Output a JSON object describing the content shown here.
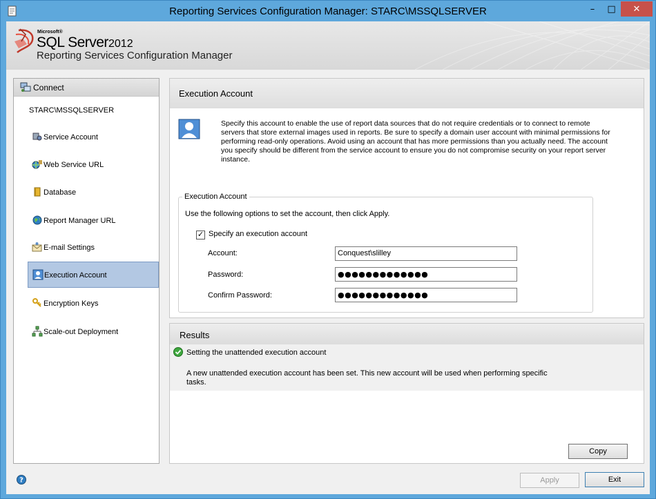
{
  "window": {
    "title": "Reporting Services Configuration Manager: STARC\\MSSQLSERVER",
    "controls": {
      "minimize": "–",
      "maximize": "□",
      "close": "✕"
    }
  },
  "banner": {
    "microsoft": "Microsoft®",
    "product": "SQL Server",
    "year": "2012",
    "subtitle": "Reporting Services Configuration Manager"
  },
  "sidebar": {
    "connect": "Connect",
    "server": "STARC\\MSSQLSERVER",
    "items": [
      {
        "label": "Service Account",
        "icon": "service-account-icon"
      },
      {
        "label": "Web Service URL",
        "icon": "web-service-icon"
      },
      {
        "label": "Database",
        "icon": "database-icon"
      },
      {
        "label": "Report Manager URL",
        "icon": "globe-icon"
      },
      {
        "label": "E-mail Settings",
        "icon": "email-icon"
      },
      {
        "label": "Execution Account",
        "icon": "user-icon",
        "selected": true
      },
      {
        "label": "Encryption Keys",
        "icon": "keys-icon"
      },
      {
        "label": "Scale-out Deployment",
        "icon": "network-icon"
      }
    ]
  },
  "main": {
    "title": "Execution Account",
    "description": "Specify this account to enable the use of report data sources that do not require credentials or to connect to remote servers that store external images used in reports. Be sure to specify a domain user account with minimal permissions for performing read-only operations. Avoid using an account that has more permissions than you actually need. The account you specify should be different from the service account to ensure you do not compromise security on your report server instance.",
    "group_title": "Execution Account",
    "instructions": "Use the following options to set the account, then click Apply.",
    "checkbox_label": "Specify an execution account",
    "checkbox_checked": "✓",
    "account_label": "Account:",
    "account_value": "Conquest\\slilley",
    "password_label": "Password:",
    "password_value": "●●●●●●●●●●●●●",
    "confirm_label": "Confirm Password:",
    "confirm_value": "●●●●●●●●●●●●●"
  },
  "results": {
    "title": "Results",
    "status": "Setting the unattended execution account",
    "detail": "A new unattended execution account has been set. This new account will be used when performing specific tasks."
  },
  "buttons": {
    "copy": "Copy",
    "apply": "Apply",
    "exit": "Exit"
  },
  "colors": {
    "selected": "#b3c8e3",
    "frame": "#5ea8dc",
    "close": "#c7514a"
  }
}
